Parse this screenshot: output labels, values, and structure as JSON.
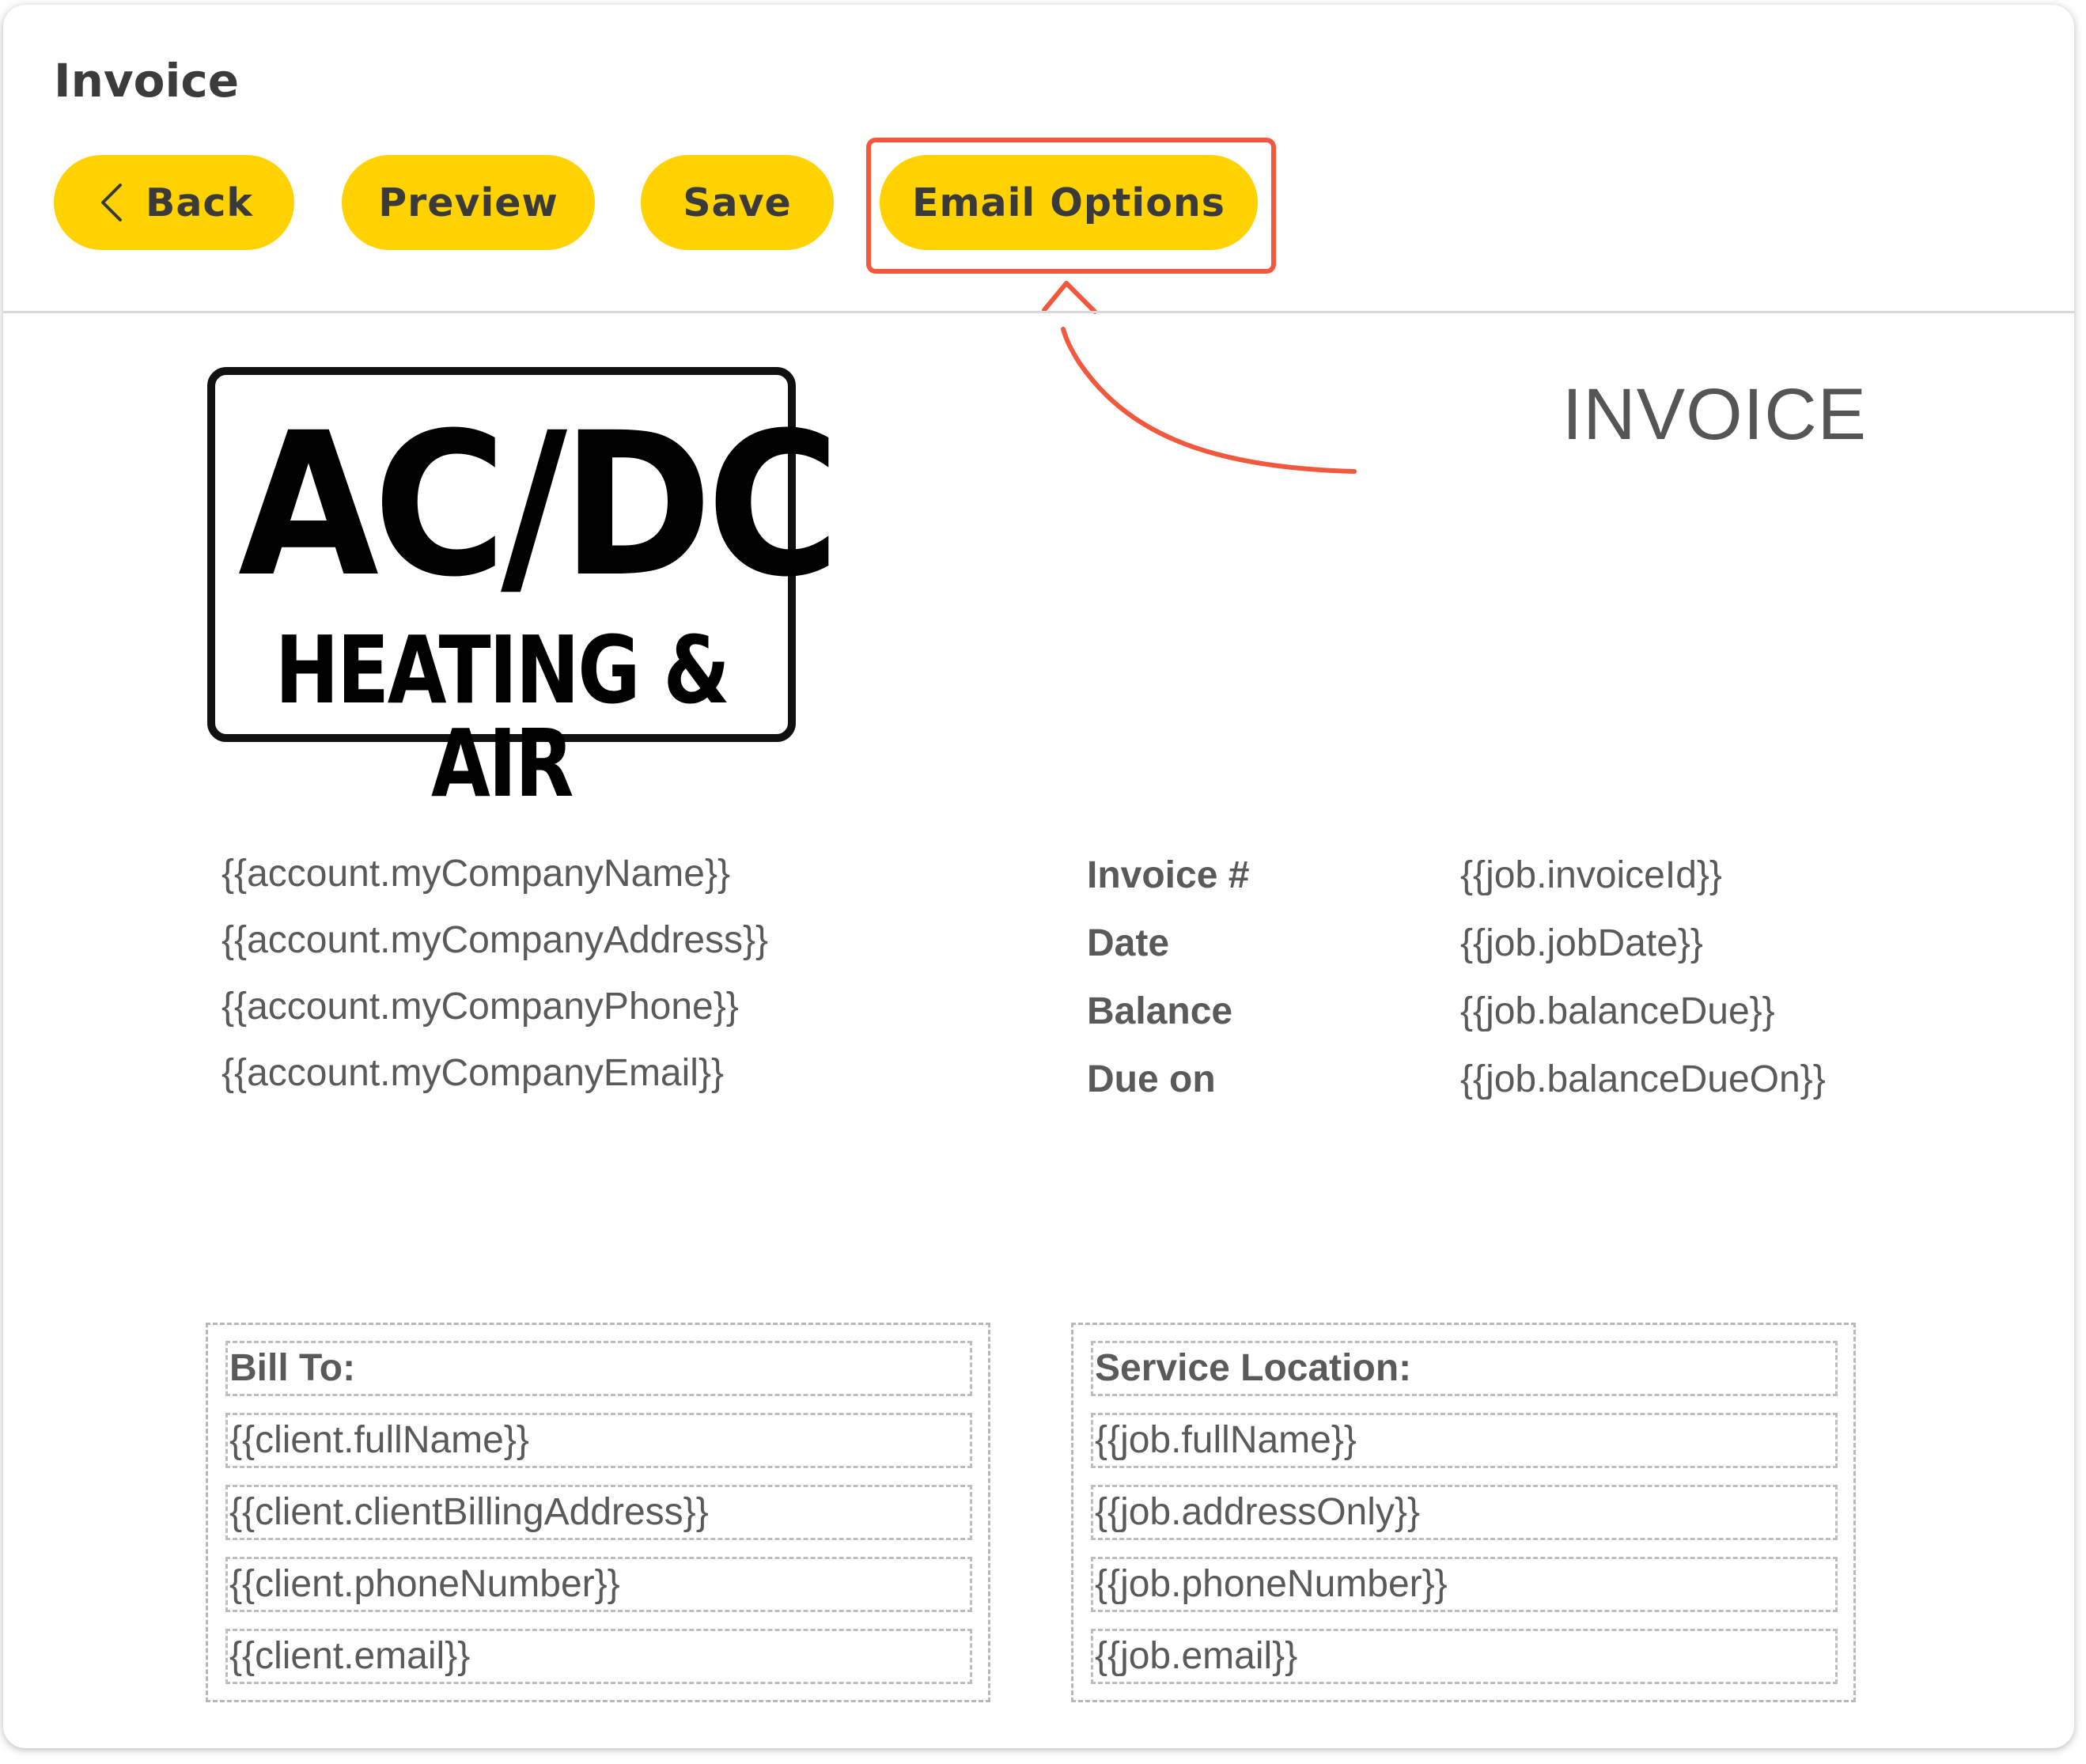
{
  "header": {
    "title": "Invoice",
    "buttons": {
      "back_label": "Back",
      "preview_label": "Preview",
      "save_label": "Save",
      "email_options_label": "Email Options"
    }
  },
  "colors": {
    "button_bg": "#ffd200",
    "highlight": "#f2583e",
    "text": "#5a5a5a"
  },
  "icons": {
    "back": "chevron-left-icon",
    "annotation": "arrow-icon"
  },
  "invoice": {
    "logo": {
      "main": "AC/DC",
      "sub": "HEATING & AIR"
    },
    "heading": "INVOICE",
    "company": [
      "{{account.myCompanyName}}",
      "{{account.myCompanyAddress}}",
      "{{account.myCompanyPhone}}",
      "{{account.myCompanyEmail}}"
    ],
    "meta": [
      {
        "label": "Invoice #",
        "value": "{{job.invoiceId}}"
      },
      {
        "label": "Date",
        "value": "{{job.jobDate}}"
      },
      {
        "label": "Balance",
        "value": "{{job.balanceDue}}"
      },
      {
        "label": "Due on",
        "value": "{{job.balanceDueOn}}"
      }
    ],
    "bill_to": {
      "heading": "Bill To:",
      "lines": [
        "{{client.fullName}}",
        "{{client.clientBillingAddress}}",
        "{{client.phoneNumber}}",
        "{{client.email}}"
      ]
    },
    "service_location": {
      "heading": "Service Location:",
      "lines": [
        "{{job.fullName}}",
        "{{job.addressOnly}}",
        "{{job.phoneNumber}}",
        "{{job.email}}"
      ]
    }
  }
}
